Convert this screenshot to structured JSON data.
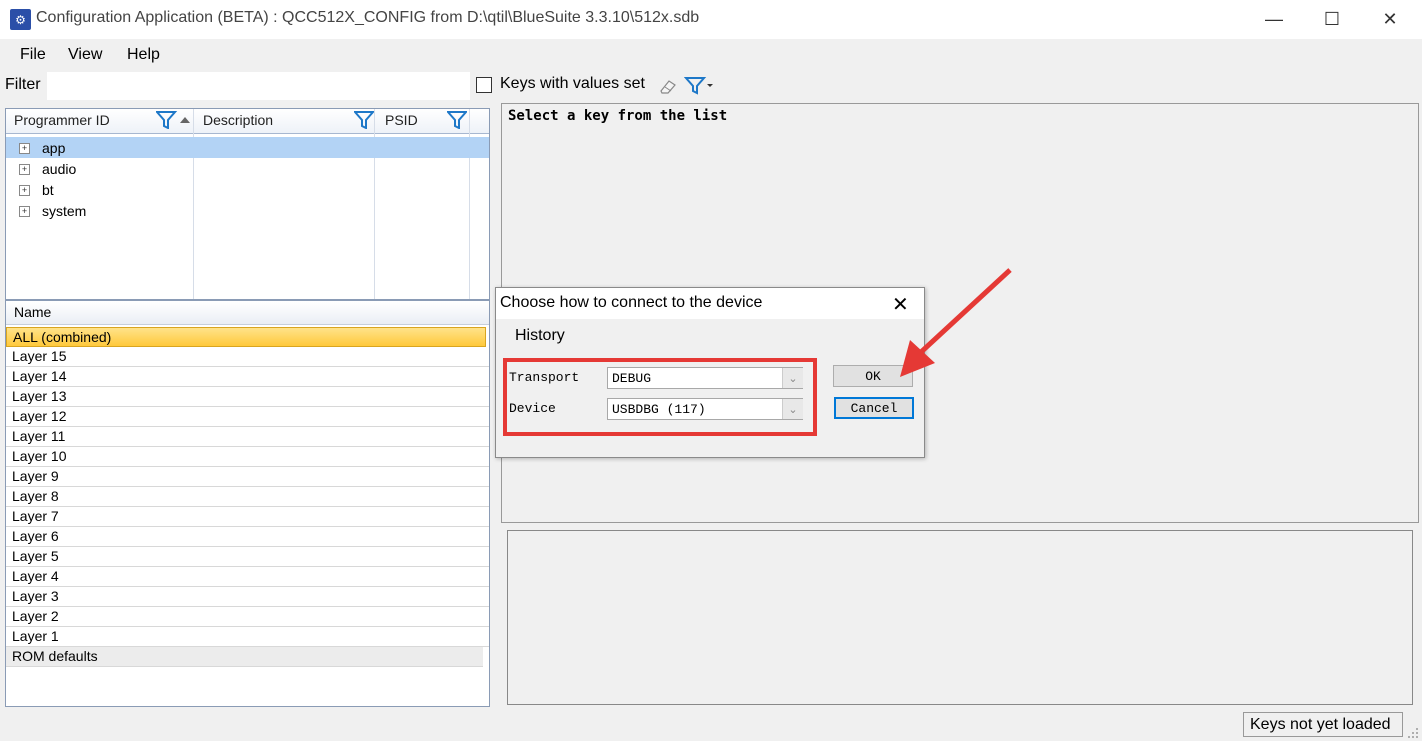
{
  "window": {
    "title": "Configuration Application (BETA) : QCC512X_CONFIG from D:\\qtil\\BlueSuite 3.3.10\\512x.sdb",
    "icon": "app-config-icon"
  },
  "menu": [
    "File",
    "View",
    "Help"
  ],
  "filter": {
    "label": "Filter",
    "value": "",
    "keys_with_values_label": "Keys with values set",
    "keys_with_values_checked": false
  },
  "tree": {
    "columns": [
      "Programmer ID",
      "Description",
      "PSID"
    ],
    "items": [
      {
        "label": "app",
        "selected": true
      },
      {
        "label": "audio",
        "selected": false
      },
      {
        "label": "bt",
        "selected": false
      },
      {
        "label": "system",
        "selected": false
      }
    ]
  },
  "layers": {
    "header": "Name",
    "items": [
      "ALL (combined)",
      "Layer 15",
      "Layer 14",
      "Layer 13",
      "Layer 12",
      "Layer 11",
      "Layer 10",
      "Layer 9",
      "Layer 8",
      "Layer 7",
      "Layer 6",
      "Layer 5",
      "Layer 4",
      "Layer 3",
      "Layer 2",
      "Layer 1",
      "ROM defaults"
    ]
  },
  "right_panel": {
    "message": "Select a key from the list"
  },
  "dialog": {
    "title": "Choose how to connect to the device",
    "history_label": "History",
    "transport_label": "Transport",
    "transport_value": "DEBUG",
    "device_label": "Device",
    "device_value": "USBDBG (117)",
    "ok_label": "OK",
    "cancel_label": "Cancel"
  },
  "status": {
    "text": "Keys not yet loaded"
  },
  "colors": {
    "highlight": "#e53935",
    "selection": "#b3d3f5",
    "filter_icon": "#1e78c8"
  }
}
